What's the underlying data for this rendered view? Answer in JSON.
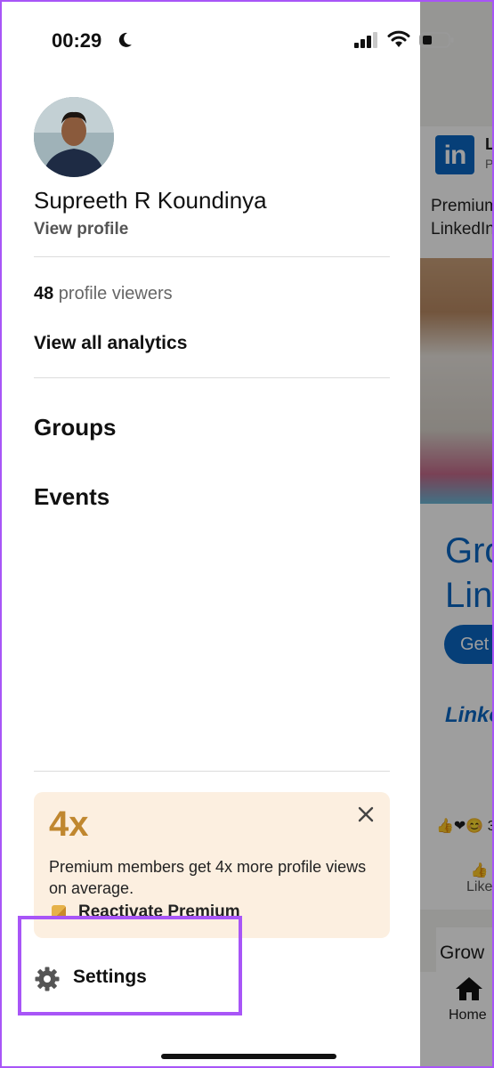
{
  "status_bar": {
    "time": "00:29",
    "icons": [
      "moon-icon",
      "cellular-signal-icon",
      "wifi-icon",
      "battery-icon"
    ]
  },
  "profile": {
    "name": "Supreeth R Koundinya",
    "view_profile": "View profile"
  },
  "analytics": {
    "viewers_count": "48",
    "viewers_label": " profile viewers",
    "view_all": "View all analytics"
  },
  "menu": {
    "groups": "Groups",
    "events": "Events"
  },
  "premium_promo": {
    "headline": "4x",
    "body": "Premium members get 4x more profile views on average.",
    "cta": "Reactivate Premium",
    "accent_color": "#c0872f",
    "background_color": "#fcefe0"
  },
  "settings": {
    "label": "Settings",
    "highlight_color": "#a855f7"
  },
  "background_app": {
    "logo_text": "in",
    "title_initial": "L",
    "subtitle_initial": "P",
    "premium_text_line1": "Premium",
    "premium_text_line2": "LinkedIn",
    "headline_line1": "Gro",
    "headline_line2": "Link",
    "button": "Get",
    "brand_text": "Linke",
    "reaction_count": "3",
    "like_label": "Like",
    "tab_label": "Grow",
    "nav_home": "Home"
  }
}
